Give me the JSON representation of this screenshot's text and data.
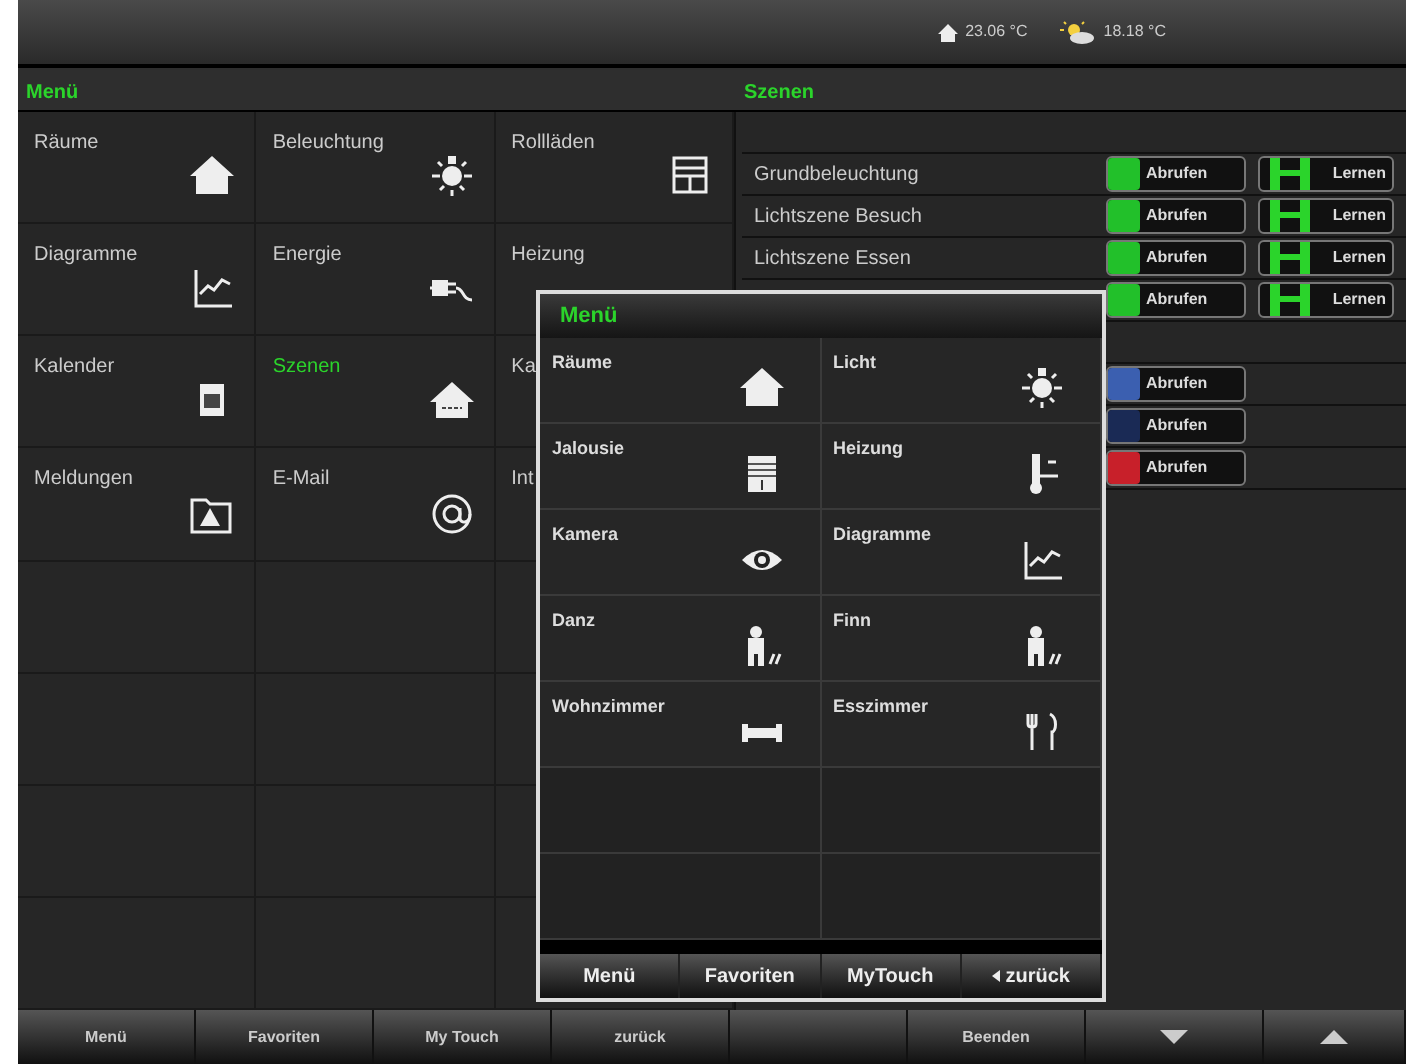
{
  "status_bar": {
    "indoor_temperature": "23.06 °C",
    "outdoor_temperature": "18.18 °C"
  },
  "menu_panel": {
    "title": "Menü",
    "tiles": [
      {
        "label": "Räume",
        "kind": "house",
        "selected": false
      },
      {
        "label": "Beleuchtung",
        "kind": "bulb",
        "selected": false
      },
      {
        "label": "Rollläden",
        "kind": "shutter",
        "selected": false
      },
      {
        "label": "Diagramme",
        "kind": "chart",
        "selected": false
      },
      {
        "label": "Energie",
        "kind": "plug",
        "selected": false
      },
      {
        "label": "Heizung",
        "selected": false
      },
      {
        "label": "Kalender",
        "kind": "calendar",
        "selected": false
      },
      {
        "label": "Szenen",
        "kind": "scene",
        "selected": true
      },
      {
        "label": "Ka",
        "selected": false
      },
      {
        "label": "Meldungen",
        "kind": "warning",
        "selected": false
      },
      {
        "label": "E-Mail",
        "kind": "at",
        "selected": false
      },
      {
        "label": "Int",
        "selected": false
      }
    ]
  },
  "scenes_panel": {
    "title": "Szenen",
    "rows": [
      {
        "kind": "blank"
      },
      {
        "kind": "scene",
        "label": "Grundbeleuchtung",
        "recall": "Abrufen",
        "color": "#22c02a",
        "learn": "Lernen"
      },
      {
        "kind": "scene",
        "label": "Lichtszene Besuch",
        "recall": "Abrufen",
        "color": "#22c02a",
        "learn": "Lernen"
      },
      {
        "kind": "scene",
        "label": "Lichtszene Essen",
        "recall": "Abrufen",
        "color": "#22c02a",
        "learn": "Lernen"
      },
      {
        "kind": "scene",
        "recall": "Abrufen",
        "color": "#22c02a",
        "learn": "Lernen"
      },
      {
        "kind": "blank"
      },
      {
        "kind": "scene",
        "recall": "Abrufen",
        "color": "#3b5fb0"
      },
      {
        "kind": "scene",
        "recall": "Abrufen",
        "color": "#1a2a55"
      },
      {
        "kind": "scene",
        "recall": "Abrufen",
        "color": "#c8202a"
      }
    ]
  },
  "popup": {
    "title": "Menü",
    "tiles": [
      {
        "label": "Räume",
        "kind": "house"
      },
      {
        "label": "Licht",
        "kind": "bulb"
      },
      {
        "label": "Jalousie",
        "kind": "blind"
      },
      {
        "label": "Heizung",
        "kind": "thermometer"
      },
      {
        "label": "Kamera",
        "kind": "eye"
      },
      {
        "label": "Diagramme",
        "kind": "chart"
      },
      {
        "label": "Danz",
        "kind": "figure"
      },
      {
        "label": "Finn",
        "kind": "figure"
      },
      {
        "label": "Wohnzimmer",
        "kind": "sofa"
      },
      {
        "label": "Esszimmer",
        "kind": "cutlery"
      }
    ],
    "buttons": [
      {
        "label": "Menü"
      },
      {
        "label": "Favoriten"
      },
      {
        "label": "MyTouch"
      },
      {
        "label": "zurück",
        "kind": "back"
      }
    ]
  },
  "bottom_bar": [
    {
      "kind": "text",
      "label": "Menü"
    },
    {
      "kind": "text",
      "label": "Favoriten"
    },
    {
      "kind": "text",
      "label": "My Touch"
    },
    {
      "kind": "text",
      "label": "zurück"
    },
    {
      "kind": "blank"
    },
    {
      "kind": "text",
      "label": "Beenden"
    },
    {
      "kind": "down"
    },
    {
      "kind": "up"
    }
  ]
}
